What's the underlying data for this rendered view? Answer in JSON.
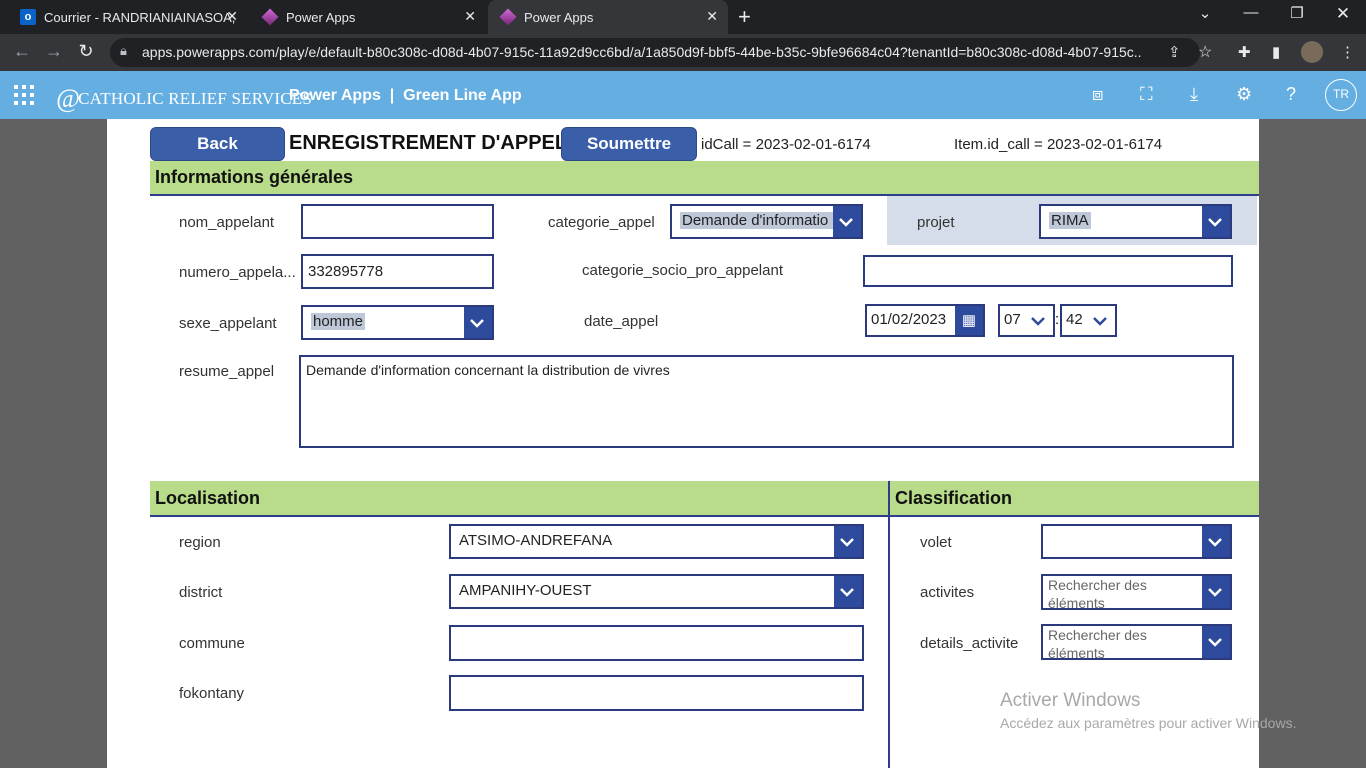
{
  "browser": {
    "tabs": [
      {
        "title": "Courrier - RANDRIANIAINASOA,",
        "icon": "outlook-icon"
      },
      {
        "title": "Power Apps",
        "icon": "powerapps-icon"
      },
      {
        "title": "Power Apps",
        "icon": "powerapps-icon",
        "active": true
      }
    ],
    "new_tab": "+",
    "url": "apps.powerapps.com/play/e/default-b80c308c-d08d-4b07-915c-11a92d9cc6bd/a/1a850d9f-bbf5-44be-b35c-9bfe96684c04?tenantId=b80c308c-d08d-4b07-915c...",
    "profile": "TR"
  },
  "app_header": {
    "logo_text": "CATHOLIC RELIEF SERVICES",
    "title": "Power Apps  |  Green Line App",
    "avatar": "TR"
  },
  "form": {
    "back_label": "Back",
    "heading": "ENREGISTREMENT D'APPEL",
    "submit_label": "Soumettre",
    "id_call": "idCall = 2023-02-01-6174",
    "item_id_call": "Item.id_call = 2023-02-01-6174",
    "general": {
      "title": "Informations générales",
      "nom_appelant": {
        "label": "nom_appelant",
        "value": ""
      },
      "categorie_appel": {
        "label": "categorie_appel",
        "value": "Demande d'informatio"
      },
      "projet": {
        "label": "projet",
        "value": "RIMA"
      },
      "numero_appelant": {
        "label": "numero_appela...",
        "value": "332895778"
      },
      "categorie_socio": {
        "label": "categorie_socio_pro_appelant",
        "value": ""
      },
      "sexe_appelant": {
        "label": "sexe_appelant",
        "value": "homme"
      },
      "date_appel": {
        "label": "date_appel",
        "date": "01/02/2023",
        "hour": "07",
        "separator": ":",
        "minute": "42"
      },
      "resume_appel": {
        "label": "resume_appel",
        "value": "Demande d'information concernant la distribution de vivres"
      }
    },
    "localisation": {
      "title": "Localisation",
      "region": {
        "label": "region",
        "value": "ATSIMO-ANDREFANA"
      },
      "district": {
        "label": "district",
        "value": "AMPANIHY-OUEST"
      },
      "commune": {
        "label": "commune",
        "value": ""
      },
      "fokontany": {
        "label": "fokontany",
        "value": ""
      }
    },
    "classification": {
      "title": "Classification",
      "volet": {
        "label": "volet",
        "value": ""
      },
      "activites": {
        "label": "activites",
        "placeholder": "Rechercher des éléments"
      },
      "details_activite": {
        "label": "details_activite",
        "placeholder": "Rechercher des éléments"
      }
    }
  },
  "watermark": {
    "line1": "Activer Windows",
    "line2": "Accédez aux paramètres pour activer Windows."
  }
}
